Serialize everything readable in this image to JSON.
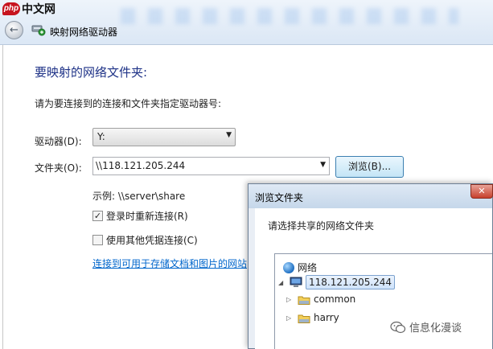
{
  "logo": {
    "mark": "php",
    "text": "中文网"
  },
  "window": {
    "title": "映射网络驱动器"
  },
  "main": {
    "heading": "要映射的网络文件夹:",
    "instruction": "请为要连接到的连接和文件夹指定驱动器号:",
    "drive_label": "驱动器(D):",
    "drive_value": "Y:",
    "folder_label": "文件夹(O):",
    "folder_value": "\\\\118.121.205.244",
    "browse_label": "浏览(B)...",
    "example": "示例: \\\\server\\share",
    "reconnect_label": "登录时重新连接(R)",
    "reconnect_checked": true,
    "other_cred_label": "使用其他凭据连接(C)",
    "other_cred_checked": false,
    "link_text": "连接到可用于存储文档和图片的网站"
  },
  "browse_dialog": {
    "title": "浏览文件夹",
    "prompt": "请选择共享的网络文件夹",
    "tree": {
      "root": "网络",
      "server": "118.121.205.244",
      "children": [
        "common",
        "harry"
      ]
    }
  },
  "watermark": {
    "text": "信息化漫谈"
  },
  "colors": {
    "heading": "#1e3287",
    "link": "#0066cc",
    "close_button": "#c7402c",
    "selection": "#cfe3fb"
  }
}
